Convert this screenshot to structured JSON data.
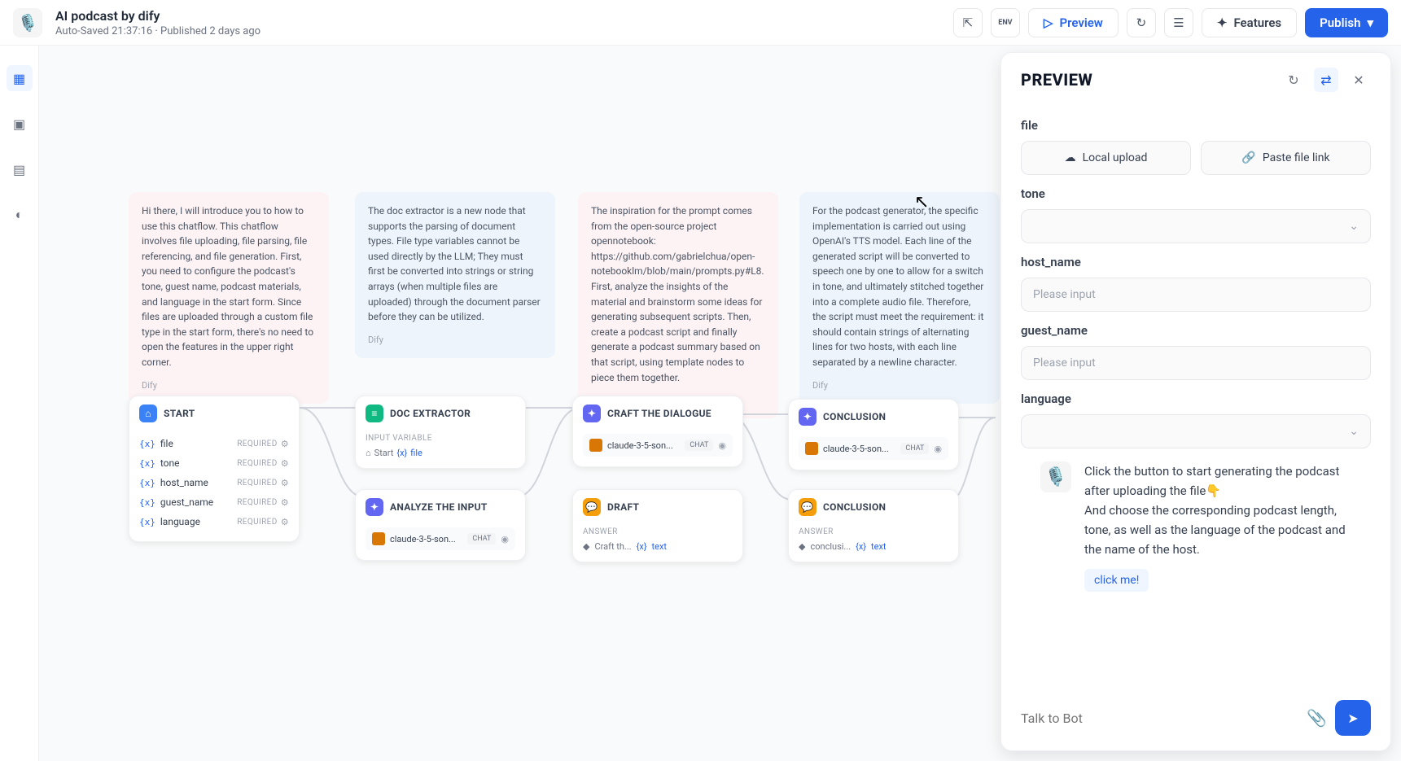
{
  "header": {
    "title": "AI podcast by dify",
    "subtitle": "Auto-Saved 21:37:16 · Published 2 days ago",
    "preview_label": "Preview",
    "features_label": "Features",
    "publish_label": "Publish",
    "env_label": "ENV"
  },
  "notes": [
    {
      "text": "Hi there, I will introduce you to how to use this chatflow. This chatflow involves file uploading, file parsing, file referencing, and file generation. First, you need to configure the podcast's tone, guest name, podcast materials, and language in the start form. Since files are uploaded through a custom file type in the start form, there's no need to open the features in the upper right corner.",
      "author": "Dify"
    },
    {
      "text": "The doc extractor is a new node that supports the parsing of document types. File type variables cannot be used directly by the LLM; They must first be converted into strings or string arrays (when multiple files are uploaded) through the document parser before they can be utilized.",
      "author": "Dify"
    },
    {
      "text": "The inspiration for the prompt comes from the open-source project opennotebook: https://github.com/gabrielchua/open-notebooklm/blob/main/prompts.py#L8. First, analyze the insights of the material and brainstorm some ideas for generating subsequent scripts. Then, create a podcast script and finally generate a podcast summary based on that script, using template nodes to piece them together.",
      "author": "Dify"
    },
    {
      "text": "For the podcast generator, the specific implementation is carried out using OpenAI's TTS model. Each line of the generated script will be converted to speech one by one to allow for a switch in tone, and ultimately stitched together into a complete audio file. Therefore, the script must meet the requirement: it should contain strings of alternating lines for two hosts, with each line separated by a newline character.",
      "author": "Dify"
    }
  ],
  "nodes": {
    "start": {
      "title": "START",
      "required_label": "REQUIRED",
      "vars": [
        {
          "name": "file"
        },
        {
          "name": "tone"
        },
        {
          "name": "host_name"
        },
        {
          "name": "guest_name"
        },
        {
          "name": "language"
        }
      ]
    },
    "doc_extractor": {
      "title": "DOC EXTRACTOR",
      "sub": "INPUT VARIABLE",
      "chip_prefix": "Start",
      "chip_var": "file"
    },
    "analyze": {
      "title": "ANALYZE THE INPUT",
      "model": "claude-3-5-son...",
      "badge": "CHAT"
    },
    "craft": {
      "title": "CRAFT THE DIALOGUE",
      "model": "claude-3-5-son...",
      "badge": "CHAT"
    },
    "conclusion_top": {
      "title": "CONCLUSION",
      "model": "claude-3-5-son...",
      "badge": "CHAT"
    },
    "draft": {
      "title": "DRAFT",
      "sub": "ANSWER",
      "chip_prefix": "Craft th...",
      "chip_var": "text"
    },
    "conclusion_bot": {
      "title": "CONCLUSION",
      "sub": "ANSWER",
      "chip_prefix": "conclusi...",
      "chip_var": "text"
    }
  },
  "panel": {
    "title": "PREVIEW",
    "file_label": "file",
    "local_upload": "Local upload",
    "paste_link": "Paste file link",
    "tone_label": "tone",
    "host_label": "host_name",
    "guest_label": "guest_name",
    "language_label": "language",
    "placeholder": "Please input",
    "bot_message": "Click the button to start generating the podcast after uploading the file👇\nAnd choose the corresponding podcast length, tone, as well as the language of the podcast and the name of the host.",
    "click_me": "click me!",
    "chat_placeholder": "Talk to Bot"
  }
}
